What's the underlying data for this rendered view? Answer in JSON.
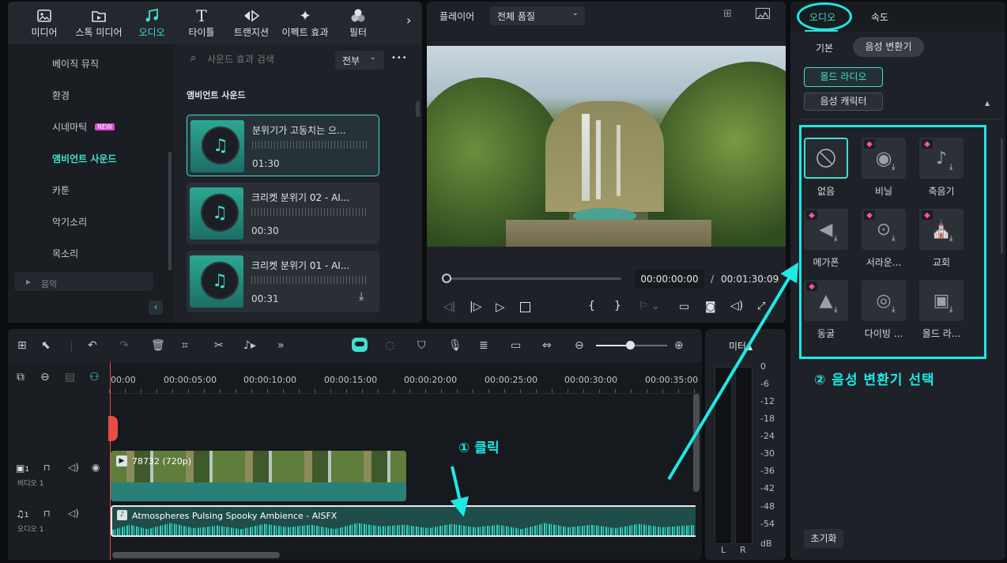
{
  "top_tabs": [
    {
      "label": "미디어",
      "icon": "media-icon"
    },
    {
      "label": "스톡 미디어",
      "icon": "stock-media-icon"
    },
    {
      "label": "오디오",
      "icon": "music-note-icon",
      "active": true
    },
    {
      "label": "타이틀",
      "icon": "title-icon"
    },
    {
      "label": "트랜지션",
      "icon": "transition-icon"
    },
    {
      "label": "이펙트 효과",
      "icon": "effects-icon"
    },
    {
      "label": "필터",
      "icon": "filter-icon"
    }
  ],
  "categories": [
    {
      "label": "베이직 뮤직"
    },
    {
      "label": "환경"
    },
    {
      "label": "시네마틱",
      "badge": "NEW"
    },
    {
      "label": "앰비언트 사운드",
      "active": true
    },
    {
      "label": "카툰"
    },
    {
      "label": "악기소리"
    },
    {
      "label": "목소리"
    },
    {
      "label": "음악"
    }
  ],
  "search": {
    "placeholder": "사운드 효과 검색",
    "filter": "전부",
    "more": "•••"
  },
  "section_title": "앰비언트 사운드",
  "sounds": [
    {
      "name": "분위기가 고동치는 으...",
      "duration": "01:30"
    },
    {
      "name": "크리켓 분위기 02 - AI...",
      "duration": "00:30"
    },
    {
      "name": "크리켓 분위기 01 - AI...",
      "duration": "00:31"
    }
  ],
  "player": {
    "label": "플레이어",
    "quality": "전체 품질",
    "current": "00:00:00:00",
    "sep": "/",
    "total": "00:01:30:09"
  },
  "right": {
    "tabs": [
      {
        "label": "오디오",
        "active": true
      },
      {
        "label": "속도"
      }
    ],
    "subtabs": [
      {
        "label": "기본"
      },
      {
        "label": "음성 변환기",
        "active": true
      }
    ],
    "pills": [
      {
        "label": "올드 라디오",
        "active": true
      },
      {
        "label": "음성 캐릭터"
      }
    ],
    "voices": [
      {
        "label": "없음",
        "icon": "none-icon",
        "selected": true
      },
      {
        "label": "비닐",
        "icon": "vinyl-icon",
        "premium": true
      },
      {
        "label": "축음기",
        "icon": "gramophone-icon",
        "premium": true
      },
      {
        "label": "메가폰",
        "icon": "megaphone-icon",
        "premium": true
      },
      {
        "label": "서라운...",
        "icon": "surround-icon",
        "premium": true
      },
      {
        "label": "교회",
        "icon": "church-icon",
        "premium": true
      },
      {
        "label": "동굴",
        "icon": "cave-icon",
        "premium": true
      },
      {
        "label": "다이빙 ...",
        "icon": "diving-icon"
      },
      {
        "label": "올드 라...",
        "icon": "old-radio-icon"
      }
    ],
    "reset": "초기화"
  },
  "annotations": {
    "step1": "① 클릭",
    "step2": "② 음성 변환기 선택",
    "color": "#1de9e6"
  },
  "timeline": {
    "ticks": [
      "00:00",
      "00:00:05:00",
      "00:00:10:00",
      "00:00:15:00",
      "00:00:20:00",
      "00:00:25:00",
      "00:00:30:00",
      "00:00:35:00"
    ],
    "video_track": {
      "label": "비디오 1",
      "num": "1",
      "clip": "78732 (720p)"
    },
    "audio_track": {
      "label": "오디오 1",
      "num": "1",
      "clip": "Atmospheres Pulsing Spooky Ambience - AISFX"
    },
    "meter": {
      "title": "미터",
      "scale": [
        "0",
        "-6",
        "-12",
        "-18",
        "-24",
        "-30",
        "-36",
        "-42",
        "-48",
        "-54",
        "dB"
      ],
      "left": "L",
      "right": "R"
    }
  },
  "colors": {
    "accent": "#3fe0d0",
    "panel": "#1e2228",
    "bg": "#0b0d10"
  }
}
